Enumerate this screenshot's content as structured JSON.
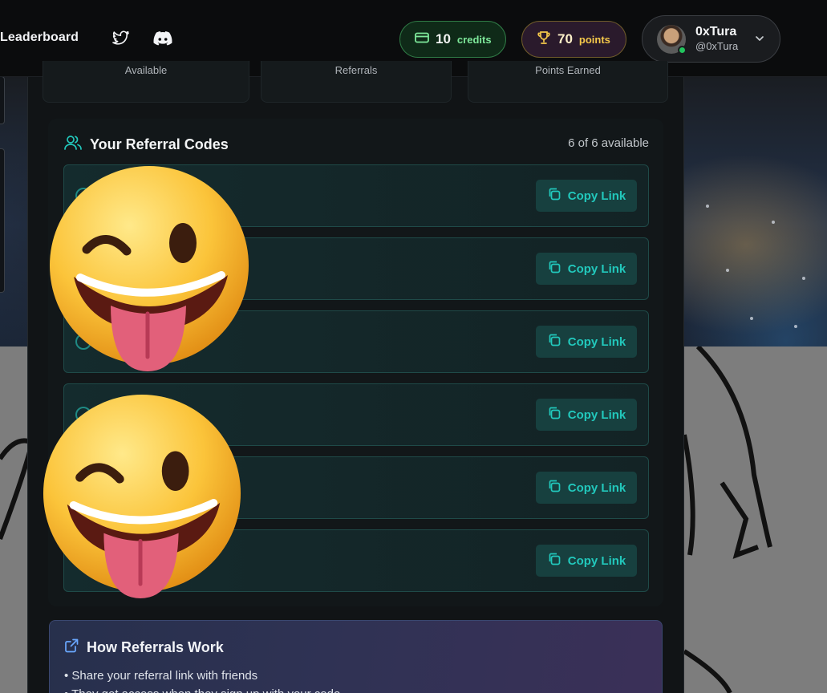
{
  "header": {
    "nav_leaderboard": "Leaderboard",
    "social": [
      {
        "name": "twitter-icon"
      },
      {
        "name": "discord-icon"
      }
    ],
    "credits": {
      "value": "10",
      "unit": "credits",
      "icon": "card-icon",
      "color": "#7ee89a"
    },
    "points": {
      "value": "70",
      "unit": "points",
      "icon": "trophy-icon",
      "color": "#f4c84a"
    },
    "user": {
      "name": "0xTura",
      "handle": "@0xTura",
      "status": "online"
    }
  },
  "stats": {
    "labels": [
      "Available",
      "Referrals",
      "Points Earned"
    ]
  },
  "referral_codes": {
    "title": "Your Referral Codes",
    "count_label": "6 of 6 available",
    "copy_label": "Copy Link",
    "accent": "#22c8bc",
    "codes": [
      "",
      "",
      "",
      "",
      "",
      ""
    ]
  },
  "how_it_works": {
    "title": "How Referrals Work",
    "items": [
      "• Share your referral link with friends",
      "• They get access when they sign up with your code"
    ]
  },
  "overlays": {
    "stickers": [
      "winking-tongue-emoji",
      "winking-tongue-emoji"
    ]
  }
}
